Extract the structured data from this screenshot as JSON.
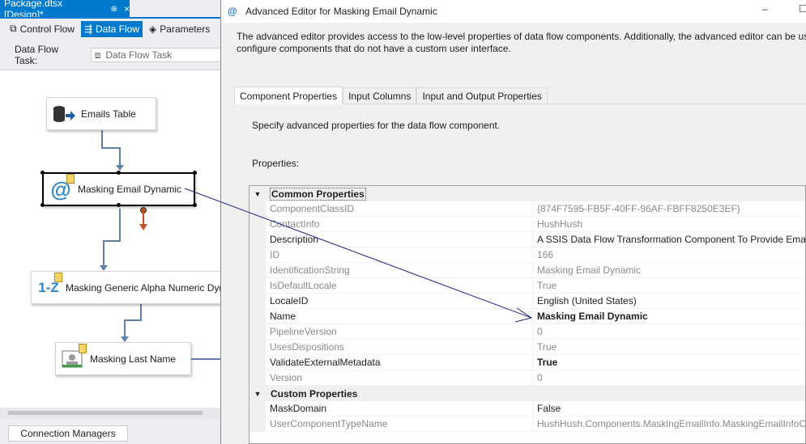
{
  "designer": {
    "doc_tab": "Package.dtsx [Design]*",
    "pin_icon": "pin-icon",
    "tabs": [
      {
        "label": "Control Flow",
        "icon": "control-flow-icon"
      },
      {
        "label": "Data Flow",
        "icon": "data-flow-icon",
        "active": true
      },
      {
        "label": "Parameters",
        "icon": "parameters-icon"
      }
    ],
    "task_label": "Data Flow Task:",
    "task_value": "Data Flow Task",
    "nodes": [
      {
        "label": "Emails Table",
        "icon": "database-source-icon"
      },
      {
        "label": "Masking Email Dynamic",
        "icon": "email-at-icon"
      },
      {
        "label": "Masking Generic Alpha Numeric Dynamic",
        "icon": "alpha-numeric-icon",
        "icon_text": "1-Z"
      },
      {
        "label": "Masking Last Name",
        "icon": "person-card-icon"
      }
    ],
    "connection_managers": "Connection Managers"
  },
  "dialog": {
    "title": "Advanced Editor for Masking Email Dynamic",
    "description_line1": "The advanced editor provides access to the low-level properties of data flow components. Additionally, the advanced editor can be us",
    "description_line2": "configure components that do not have a custom user interface.",
    "tabs": [
      "Component Properties",
      "Input Columns",
      "Input and Output Properties"
    ],
    "instruction": "Specify advanced properties for the data flow component.",
    "properties_label": "Properties:",
    "categories": [
      {
        "name": "Common Properties",
        "rows": [
          {
            "name": "ComponentClassID",
            "value": "{874F7595-FB5F-40FF-96AF-FBFF8250E3EF}",
            "readonly": true
          },
          {
            "name": "ContactInfo",
            "value": "HushHush",
            "readonly": true
          },
          {
            "name": "Description",
            "value": "A SSIS Data Flow Transformation Component To Provide Email",
            "readonly": false
          },
          {
            "name": "ID",
            "value": "166",
            "readonly": true
          },
          {
            "name": "IdentificationString",
            "value": "Masking Email Dynamic",
            "readonly": true
          },
          {
            "name": "IsDefaultLocale",
            "value": "True",
            "readonly": true
          },
          {
            "name": "LocaleID",
            "value": "English (United States)",
            "readonly": false
          },
          {
            "name": "Name",
            "value": "Masking Email Dynamic",
            "readonly": false,
            "bold_value": true
          },
          {
            "name": "PipelineVersion",
            "value": "0",
            "readonly": true
          },
          {
            "name": "UsesDispositions",
            "value": "True",
            "readonly": true
          },
          {
            "name": "ValidateExternalMetadata",
            "value": "True",
            "readonly": false,
            "bold_value": true
          },
          {
            "name": "Version",
            "value": "0",
            "readonly": true
          }
        ]
      },
      {
        "name": "Custom Properties",
        "rows": [
          {
            "name": "MaskDomain",
            "value": "False",
            "readonly": false
          },
          {
            "name": "UserComponentTypeName",
            "value": "HushHush.Components.MaskingEmailInfo.MaskingEmailInfoC",
            "readonly": true
          }
        ]
      }
    ]
  },
  "colors": {
    "accent": "#007acc",
    "arrow": "#6080a8",
    "error_arrow": "#c0501e",
    "callout": "#1f2a8a"
  }
}
